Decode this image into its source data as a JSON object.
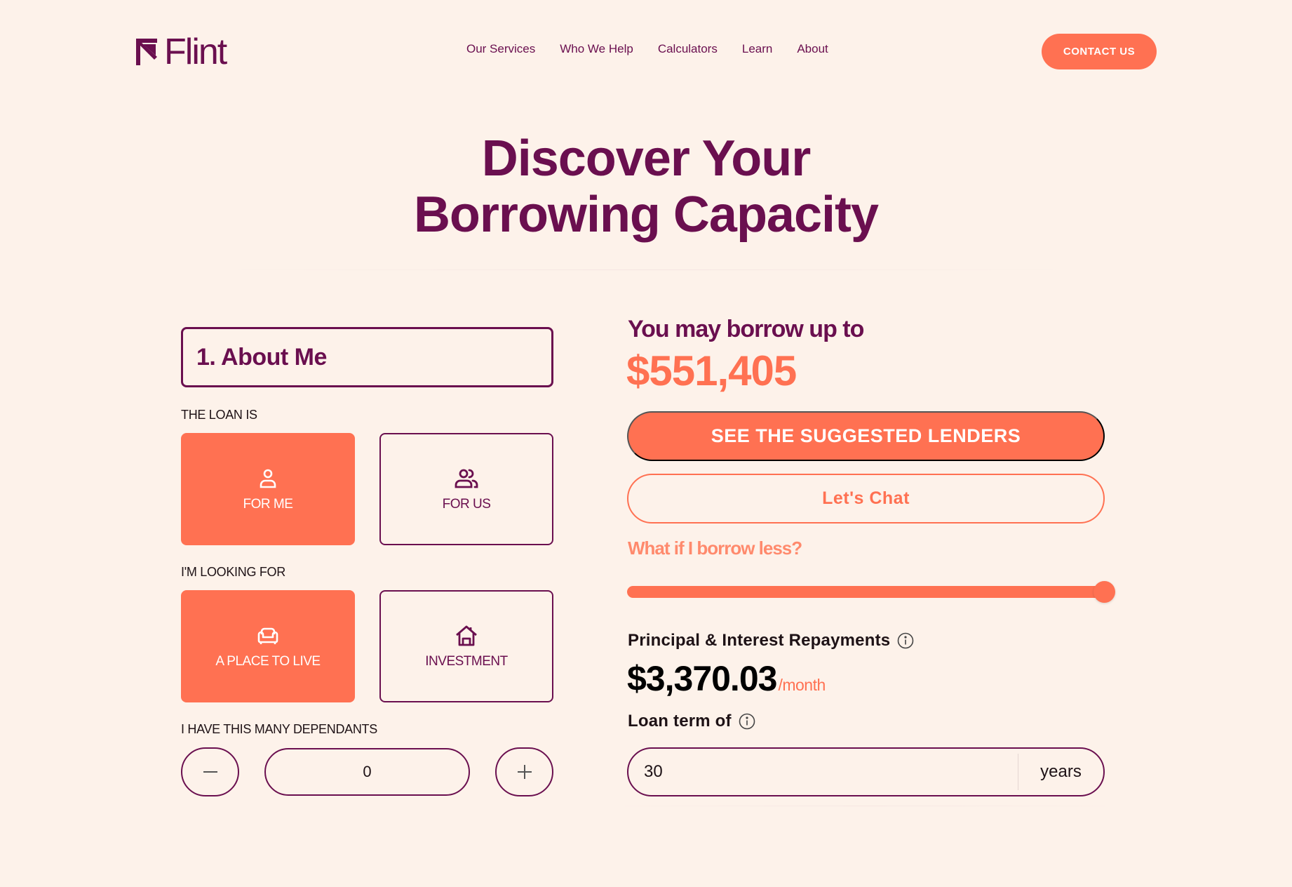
{
  "header": {
    "logo_text": "Flint",
    "nav": [
      "Our Services",
      "Who We Help",
      "Calculators",
      "Learn",
      "About"
    ],
    "contact_label": "CONTACT US"
  },
  "hero": {
    "title_line1": "Discover Your",
    "title_line2": "Borrowing Capacity"
  },
  "about": {
    "section_title": "1. About Me",
    "loan_label": "THE LOAN IS",
    "loan_options": [
      {
        "label": "FOR ME",
        "icon": "person-icon",
        "selected": true
      },
      {
        "label": "FOR US",
        "icon": "people-icon",
        "selected": false
      }
    ],
    "looking_label": "I'M LOOKING FOR",
    "looking_options": [
      {
        "label": "A PLACE TO LIVE",
        "icon": "sofa-icon",
        "selected": true
      },
      {
        "label": "INVESTMENT",
        "icon": "house-icon",
        "selected": false
      }
    ],
    "dependants_label": "I HAVE THIS MANY DEPENDANTS",
    "dependants_value": "0"
  },
  "result": {
    "borrow_heading": "You may borrow up to",
    "borrow_amount": "$551,405",
    "lenders_label": "SEE THE SUGGESTED LENDERS",
    "chat_label": "Let's Chat",
    "borrow_less_label": "What if I borrow less?",
    "slider_fraction": 1.0,
    "repayments_label": "Principal & Interest Repayments",
    "repayments_value": "$3,370.03",
    "repayments_unit": "/month",
    "term_label": "Loan term of",
    "term_value": "30",
    "term_unit": "years"
  },
  "colors": {
    "background": "#fdf2ea",
    "plum": "#6a0f4f",
    "coral": "#ff7152"
  }
}
